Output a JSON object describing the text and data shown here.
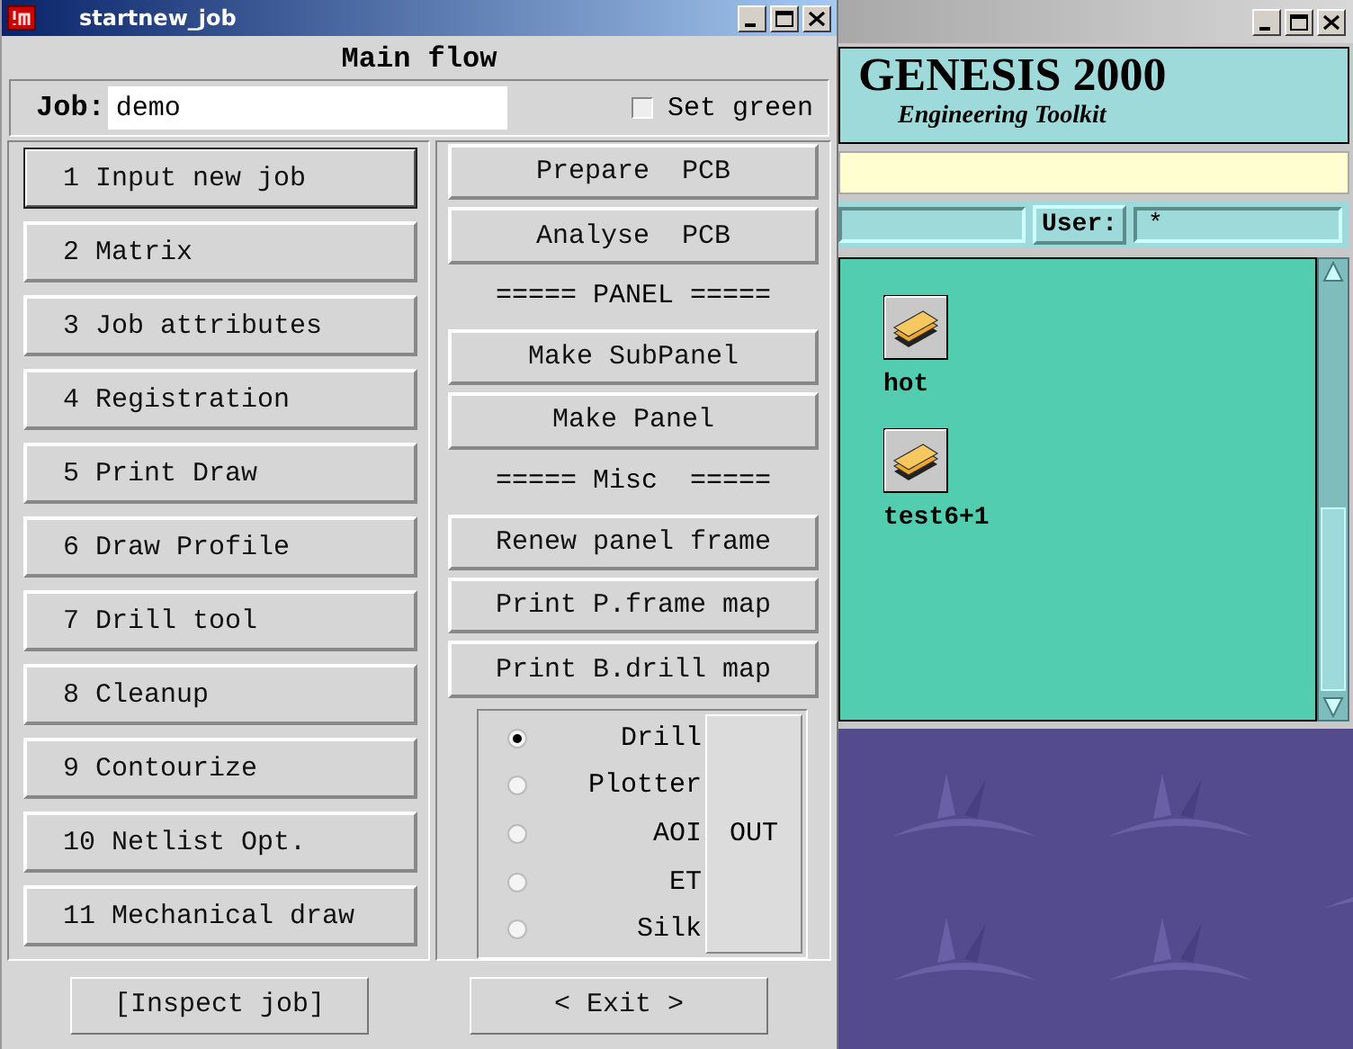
{
  "dialog": {
    "title": "startnew_job",
    "heading": "Main flow",
    "job": {
      "label": "Job:",
      "value": "demo"
    },
    "set_green": {
      "label": "Set green",
      "checked": false
    },
    "steps": [
      {
        "label": "1 Input new job",
        "default": true
      },
      {
        "label": "2 Matrix",
        "default": false
      },
      {
        "label": "3 Job attributes",
        "default": false
      },
      {
        "label": "4 Registration",
        "default": false
      },
      {
        "label": "5 Print Draw",
        "default": false
      },
      {
        "label": "6 Draw Profile",
        "default": false
      },
      {
        "label": "7 Drill tool",
        "default": false
      },
      {
        "label": "8 Cleanup",
        "default": false
      },
      {
        "label": "9 Contourize",
        "default": false
      },
      {
        "label": "10 Netlist Opt.",
        "default": false
      },
      {
        "label": "11 Mechanical draw",
        "default": false
      }
    ],
    "tools": [
      {
        "kind": "button",
        "label": "Prepare  PCB"
      },
      {
        "kind": "button",
        "label": "Analyse  PCB"
      },
      {
        "kind": "separator",
        "label": "===== PANEL ====="
      },
      {
        "kind": "button",
        "label": "Make SubPanel"
      },
      {
        "kind": "button",
        "label": "Make Panel"
      },
      {
        "kind": "separator",
        "label": "===== Misc  ====="
      },
      {
        "kind": "button",
        "label": "Renew panel frame"
      },
      {
        "kind": "button",
        "label": "Print P.frame map"
      },
      {
        "kind": "button",
        "label": "Print B.drill map"
      }
    ],
    "output": {
      "options": [
        {
          "label": "Drill",
          "selected": true
        },
        {
          "label": "Plotter",
          "selected": false
        },
        {
          "label": "AOI",
          "selected": false
        },
        {
          "label": "ET",
          "selected": false
        },
        {
          "label": "Silk",
          "selected": false
        }
      ],
      "button": "OUT"
    },
    "footer": [
      "[Inspect job]",
      "< Exit >"
    ]
  },
  "background_window": {
    "title": "GENESIS 2000",
    "subtitle": "Engineering Toolkit",
    "user_label": "User:",
    "user_value": "*",
    "jobs": [
      {
        "name": "hot"
      },
      {
        "name": "test6+1"
      }
    ]
  }
}
